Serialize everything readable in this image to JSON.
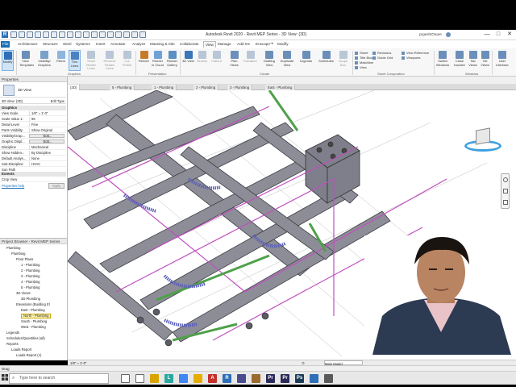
{
  "app": {
    "title": "Autodesk Revit 2020 - Revit MEP Series - 3D View: {3D}",
    "user": "prgeshtOsare",
    "window_controls": [
      "—",
      "□",
      "✕"
    ]
  },
  "ribbon_tabs": [
    "File",
    "Architecture",
    "Structure",
    "Steel",
    "Systems",
    "Insert",
    "Annotate",
    "Analyze",
    "Massing & Site",
    "Collaborate",
    "View",
    "Manage",
    "Add-Ins",
    "Enscape™",
    "Modify"
  ],
  "ribbon": {
    "buttons": [
      {
        "label": "Modify",
        "color": "#2e6fb7"
      },
      {
        "label": "View Templates",
        "color": "#6b8fb8"
      },
      {
        "label": "Visibility/ Graphics",
        "color": "#7aa1c9"
      },
      {
        "label": "Filters",
        "color": "#8db5de"
      },
      {
        "label": "Thin Lines",
        "color": "#4c82c0"
      },
      {
        "label": "Show Hidden Lines",
        "color": "#b9c6d6"
      },
      {
        "label": "Remove Hidden Lines",
        "color": "#b9c6d6"
      },
      {
        "label": "Cut Profile",
        "color": "#b9c6d6"
      },
      {
        "label": "Render",
        "color": "#c77b2a"
      },
      {
        "label": "Render in Cloud",
        "color": "#6fa2d6"
      },
      {
        "label": "Render Gallery",
        "color": "#5c8fc4"
      },
      {
        "label": "3D View",
        "color": "#3b76b8"
      },
      {
        "label": "Section",
        "color": "#b9c6d6"
      },
      {
        "label": "Callout",
        "color": "#b9c6d6"
      },
      {
        "label": "Plan Views",
        "color": "#6b8fb8"
      },
      {
        "label": "Elevation",
        "color": "#b9c6d6"
      },
      {
        "label": "Drafting View",
        "color": "#6b8fb8"
      },
      {
        "label": "Duplicate View",
        "color": "#6b8fb8"
      },
      {
        "label": "Legends",
        "color": "#6b8fb8"
      },
      {
        "label": "Schedules",
        "color": "#6b8fb8"
      },
      {
        "label": "Scope Box",
        "color": "#b9c6d6"
      },
      {
        "label": "Switch Windows",
        "color": "#6b8fb8"
      },
      {
        "label": "Close Inactive",
        "color": "#6b8fb8"
      },
      {
        "label": "Tab Views",
        "color": "#6b8fb8"
      },
      {
        "label": "Tile Views",
        "color": "#6b8fb8"
      },
      {
        "label": "User Interface",
        "color": "#6b8fb8"
      }
    ],
    "small_items": [
      "Sheet",
      "Title Block",
      "Matchline",
      "View",
      "Revisions",
      "Guide Grid",
      "View Reference",
      "Viewports"
    ],
    "panels": [
      "Graphics",
      "Presentation",
      "Create",
      "Sheet Composition",
      "Windows"
    ]
  },
  "view_tabs": [
    "{3D}",
    "5 - Plumbing",
    "1 - Plumbing",
    "2 - Plumbing",
    "3 - Plumbing",
    "East - Plumbing"
  ],
  "properties": {
    "title": "Properties",
    "type_name": "3D View",
    "selector": "3D View: {3D}",
    "edit_type": "Edit Type",
    "group_graphics": "Graphics",
    "rows": [
      {
        "k": "View Scale",
        "v": "1/8\" = 1'-0\""
      },
      {
        "k": "Scale Value 1:",
        "v": "96"
      },
      {
        "k": "Detail Level",
        "v": "Fine"
      },
      {
        "k": "Parts Visibility",
        "v": "Show Original"
      },
      {
        "k": "Visibility/Grap...",
        "v": "Edit..."
      },
      {
        "k": "Graphic Displ...",
        "v": "Edit..."
      },
      {
        "k": "Discipline",
        "v": "Mechanical"
      },
      {
        "k": "Show Hidden...",
        "v": "By Discipline"
      },
      {
        "k": "Default Analys...",
        "v": "None"
      },
      {
        "k": "Sub-Discipline",
        "v": "HVAC"
      },
      {
        "k": "Sun Path",
        "v": ""
      }
    ],
    "group_extents": "Extents",
    "crop_view": "Crop View",
    "help": "Properties help",
    "apply": "Apply"
  },
  "browser": {
    "title": "Project Browser - Revit MEP Series",
    "items": [
      {
        "t": "Plumbing",
        "lvl": 1
      },
      {
        "t": "Plumbing",
        "lvl": 2
      },
      {
        "t": "Floor Plans",
        "lvl": 3
      },
      {
        "t": "1 - Plumbing",
        "lvl": 4
      },
      {
        "t": "2 - Plumbing",
        "lvl": 4
      },
      {
        "t": "3 - Plumbing",
        "lvl": 4
      },
      {
        "t": "4 - Plumbing",
        "lvl": 4
      },
      {
        "t": "5 - Plumbing",
        "lvl": 4
      },
      {
        "t": "3D Views",
        "lvl": 3
      },
      {
        "t": "3D Plumbing",
        "lvl": 4
      },
      {
        "t": "Elevations (Building El",
        "lvl": 3
      },
      {
        "t": "East - Plumbing",
        "lvl": 4
      },
      {
        "t": "North - Plumbing",
        "lvl": 4
      },
      {
        "t": "South - Plumbing",
        "lvl": 4
      },
      {
        "t": "West - Plumbing",
        "lvl": 4
      },
      {
        "t": "Legends",
        "lvl": 1
      },
      {
        "t": "Schedules/Quantities (all)",
        "lvl": 1
      },
      {
        "t": "Reports",
        "lvl": 1
      },
      {
        "t": "Loads Report",
        "lvl": 2
      },
      {
        "t": "Loads Report (1)",
        "lvl": 3
      }
    ],
    "highlighted": "North - Plumbing"
  },
  "view_control": {
    "scale": "1/8\" = 1'-0\"",
    "model": "Main Model",
    "zero": ":0"
  },
  "status": {
    "text": "Drag"
  },
  "taskbar": {
    "search_placeholder": "Type here to search",
    "apps": [
      {
        "label": "",
        "color": "#ffffff"
      },
      {
        "label": "",
        "color": "#ffffff"
      },
      {
        "label": "",
        "color": "#d9a400"
      },
      {
        "label": "L",
        "color": "#2aa8a0"
      },
      {
        "label": "",
        "color": "#4285f4"
      },
      {
        "label": "",
        "color": "#e8ab00"
      },
      {
        "label": "A",
        "color": "#c4302b"
      },
      {
        "label": "R",
        "color": "#2e6fb7"
      },
      {
        "label": "",
        "color": "#4b4b8f"
      },
      {
        "label": "",
        "color": "#9c6a2e"
      },
      {
        "label": "Pr",
        "color": "#2b2b5a"
      },
      {
        "label": "Pr",
        "color": "#2b2b5a"
      },
      {
        "label": "Ps",
        "color": "#1c3d5a"
      },
      {
        "label": "",
        "color": "#2e6fb7"
      },
      {
        "label": "",
        "color": "#5a5a5a"
      }
    ]
  }
}
